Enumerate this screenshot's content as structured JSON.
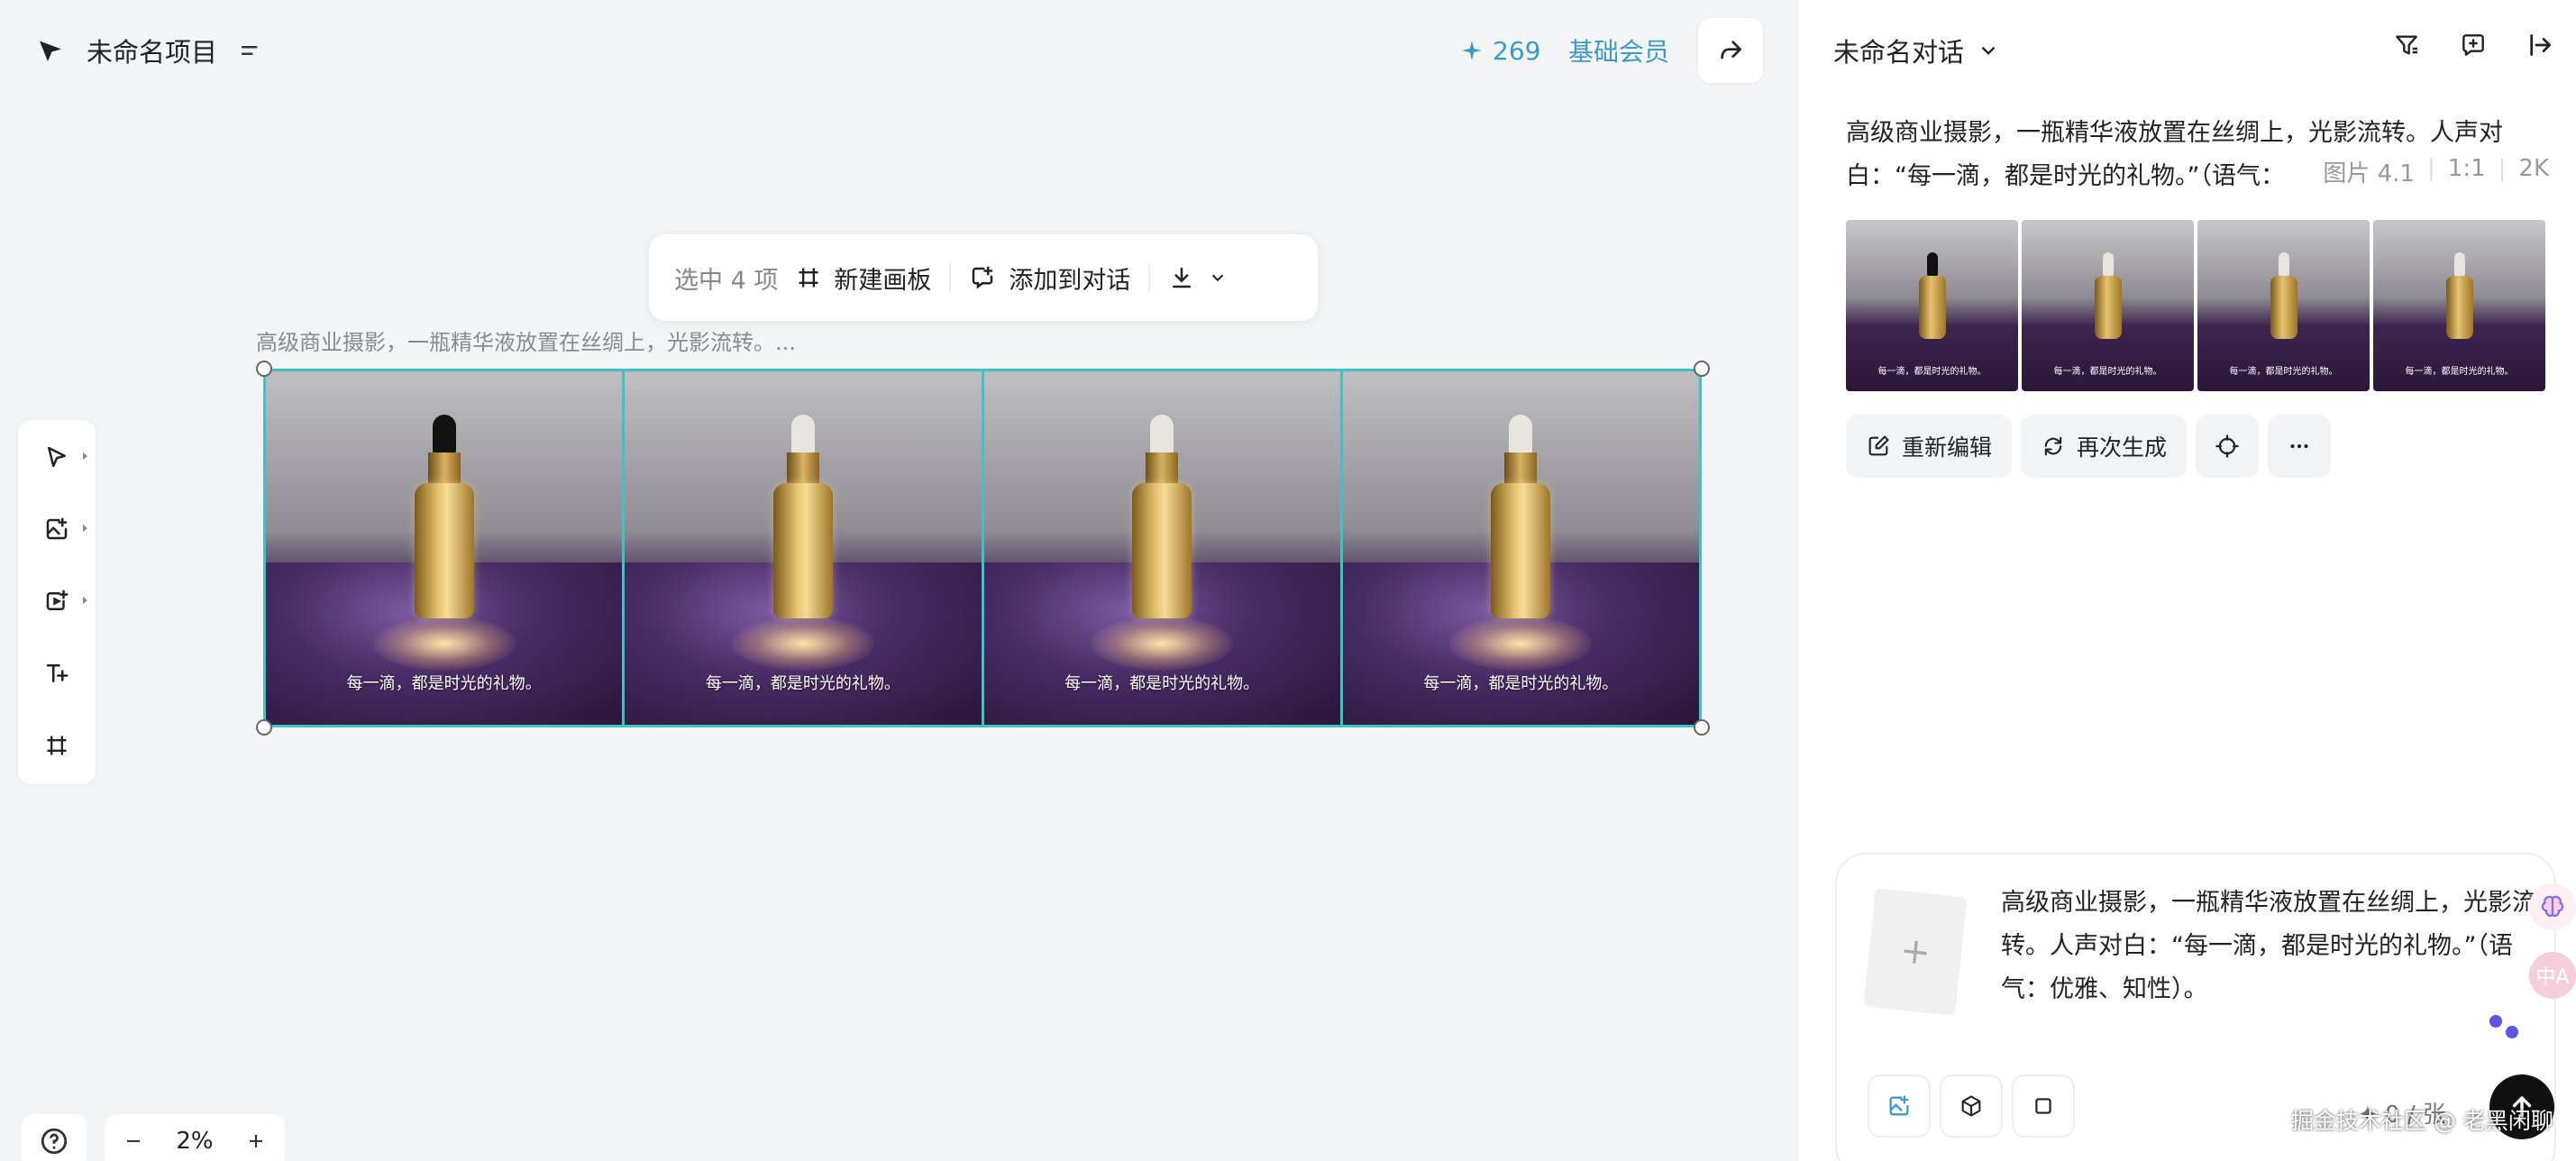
{
  "header": {
    "project_title": "未命名项目",
    "credits": "269",
    "membership": "基础会员"
  },
  "selection_toolbar": {
    "count_label": "选中 4 项",
    "new_board_label": "新建画板",
    "add_to_chat_label": "添加到对话"
  },
  "canvas": {
    "caption": "高级商业摄影，一瓶精华液放置在丝绸上，光影流转。...",
    "frames": [
      {
        "overlay_text": "每一滴，都是时光的礼物。"
      },
      {
        "overlay_text": "每一滴，都是时光的礼物。"
      },
      {
        "overlay_text": "每一滴，都是时光的礼物。"
      },
      {
        "overlay_text": "每一滴，都是时光的礼物。"
      }
    ],
    "zoom": "2%"
  },
  "panel": {
    "title": "未命名对话",
    "prompt_text": "高级商业摄影，一瓶精华液放置在丝绸上，光影流转。人声对白：“每一滴，都是时光的礼物。”（语气：",
    "meta": {
      "model": "图片 4.1",
      "ratio": "1:1",
      "resolution": "2K"
    },
    "thumb_text": "每一滴，都是时光的礼物。",
    "actions": {
      "re_edit": "重新编辑",
      "regenerate": "再次生成"
    }
  },
  "composer": {
    "attach_symbol": "+",
    "text": "高级商业摄影，一瓶精华液放置在丝绸上，光影流转。人声对白：“每一滴，都是时光的礼物。”（语气：优雅、知性）。",
    "cost": "✦ 0 / 张"
  },
  "floating": {
    "translate_label": "中A"
  },
  "watermark": "掘金技术社区 @ 老黑闲聊",
  "colors": {
    "accent": "#3a9bc8",
    "selection": "#3cc4c4",
    "send": "#111111"
  }
}
